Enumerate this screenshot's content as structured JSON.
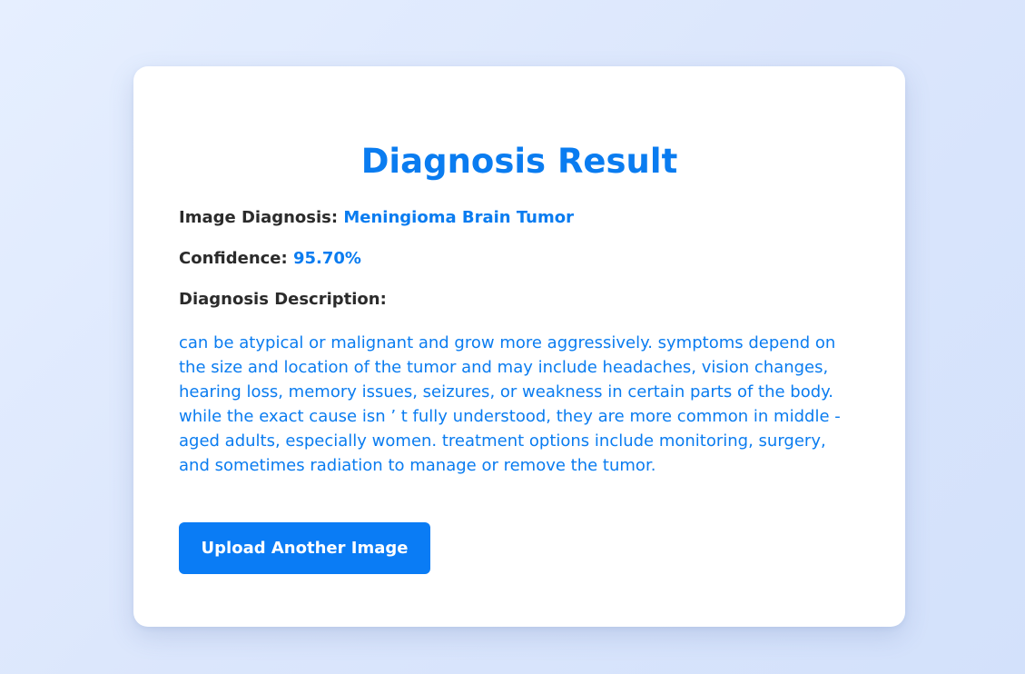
{
  "result": {
    "title": "Diagnosis Result",
    "image_diagnosis_label": "Image Diagnosis:",
    "image_diagnosis_value": "Meningioma Brain Tumor",
    "confidence_label": "Confidence:",
    "confidence_value": "95.70%",
    "description_label": "Diagnosis Description:",
    "description_text": "can be atypical or malignant and grow more aggressively. symptoms depend on the size and location of the tumor and may include headaches, vision changes, hearing loss, memory issues, seizures, or weakness in certain parts of the body. while the exact cause isn ’ t fully understood, they are more common in middle - aged adults, especially women. treatment options include monitoring, surgery, and sometimes radiation to manage or remove the tumor.",
    "upload_button_label": "Upload Another Image"
  },
  "colors": {
    "accent": "#0a7cf0",
    "button": "#0a7cf5",
    "card": "#ffffff",
    "background": "#dbe6fc"
  }
}
